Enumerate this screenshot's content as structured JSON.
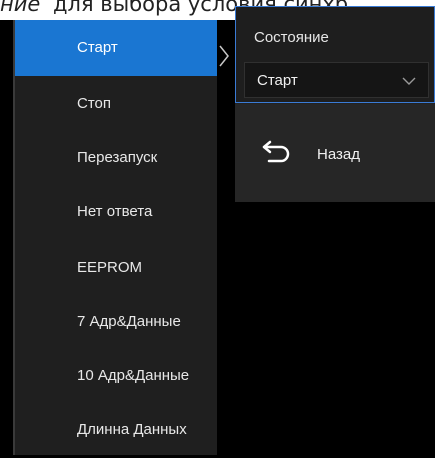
{
  "top_caption": {
    "highlight": "ние",
    "rest": "для выбора условия синхр"
  },
  "menu": {
    "items": [
      {
        "label": "Старт"
      },
      {
        "label": "Стоп"
      },
      {
        "label": "Перезапуск"
      },
      {
        "label": "Нет ответа"
      },
      {
        "label": "EEPROM"
      },
      {
        "label": "7 Адр&Данные"
      },
      {
        "label": "10 Адр&Данные"
      },
      {
        "label": "Длинна Данных"
      }
    ],
    "active_index": 0
  },
  "panel": {
    "label": "Состояние",
    "select": {
      "value": "Старт"
    },
    "back_label": "Назад"
  },
  "colors": {
    "accent": "#1a76d2",
    "menu_bg": "#1f1f1f",
    "panel_border": "#3a7bd5"
  },
  "icons": {
    "chevron_right": "chevron-right-icon",
    "chevron_down": "chevron-down-icon",
    "back": "back-arrow-icon"
  }
}
